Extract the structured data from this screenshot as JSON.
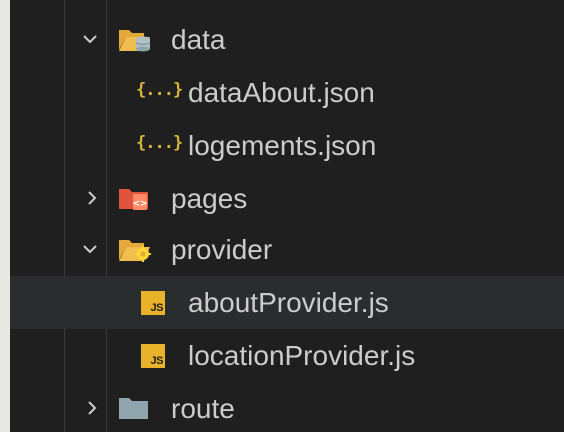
{
  "tree": {
    "items": [
      {
        "label": "data",
        "icon": "folder-database-open-icon",
        "expanded": true
      },
      {
        "label": "dataAbout.json",
        "icon": "json-file-icon"
      },
      {
        "label": "logements.json",
        "icon": "json-file-icon"
      },
      {
        "label": "pages",
        "icon": "folder-pages-icon",
        "expanded": false
      },
      {
        "label": "provider",
        "icon": "folder-provider-open-icon",
        "expanded": true
      },
      {
        "label": "aboutProvider.js",
        "icon": "js-file-icon",
        "hovered": true
      },
      {
        "label": "locationProvider.js",
        "icon": "js-file-icon"
      },
      {
        "label": "route",
        "icon": "folder-icon",
        "expanded": false
      }
    ],
    "js_badge_text": "JS",
    "json_icon_text": "{...}"
  },
  "colors": {
    "background": "#1f1f1f",
    "text": "#cccccc",
    "hover_row": "#2a2d2e",
    "json_icon": "#d6b43a",
    "js_badge": "#e8b32b",
    "folder_data": "#e3a93a",
    "folder_pages": "#e0533c",
    "folder_provider": "#e3a93a",
    "folder_route": "#90a4ae"
  }
}
